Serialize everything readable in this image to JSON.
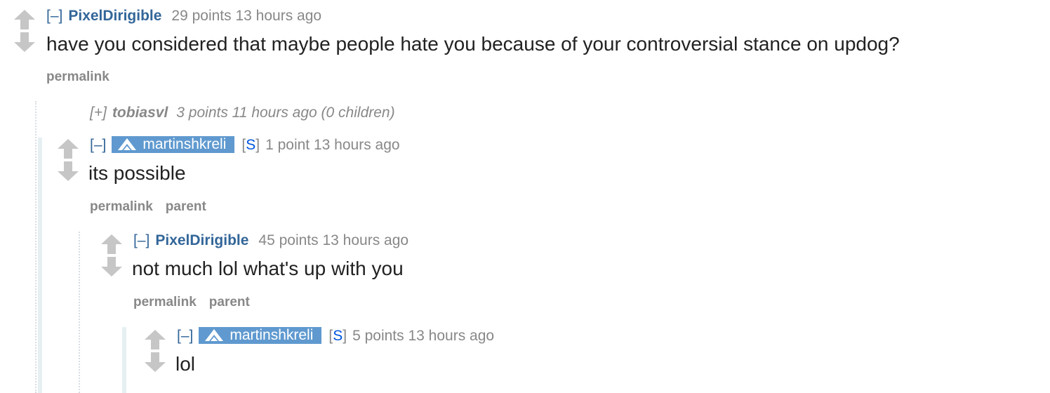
{
  "comments": {
    "c1": {
      "toggle": "[–]",
      "author": "PixelDirigible",
      "meta": "29 points 13 hours ago",
      "body": "have you considered that maybe people hate you because of your controversial stance on updog?",
      "buttons": [
        "permalink"
      ]
    },
    "c2": {
      "toggle": "[+]",
      "author": "tobiasvl",
      "meta": "3 points 11 hours ago (0 children)"
    },
    "c3": {
      "toggle": "[–]",
      "author": "martinshkreli",
      "submitter": "S",
      "meta": "1 point 13 hours ago",
      "body": "its possible",
      "buttons": [
        "permalink",
        "parent"
      ]
    },
    "c4": {
      "toggle": "[–]",
      "author": "PixelDirigible",
      "meta": "45 points 13 hours ago",
      "body": "not much lol what's up with you",
      "buttons": [
        "permalink",
        "parent"
      ]
    },
    "c5": {
      "toggle": "[–]",
      "author": "martinshkreli",
      "submitter": "S",
      "meta": "5 points 13 hours ago",
      "body": "lol"
    }
  },
  "icons": {
    "upvote": "upvote-arrow-icon",
    "downvote": "downvote-arrow-icon",
    "admin": "admin-shield-icon"
  },
  "colors": {
    "link": "#336699",
    "meta": "#888888",
    "badge": "#5f99cf",
    "submitter": "#0055df",
    "arrow": "#c6c6c6",
    "thread_line": "#dde3ea",
    "thread_line_op": "#e0eef2"
  }
}
